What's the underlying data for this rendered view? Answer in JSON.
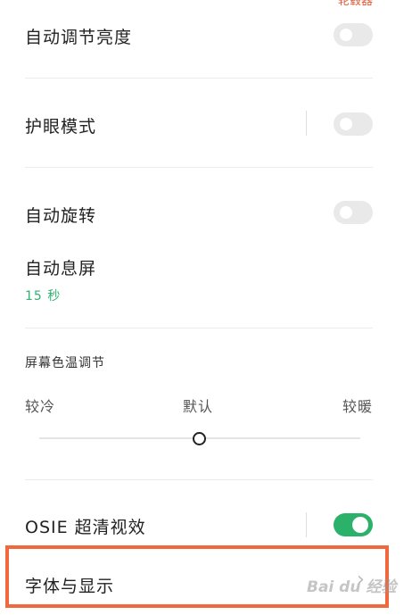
{
  "top_cut_text": "轮毂器",
  "rows": {
    "auto_brightness": {
      "label": "自动调节亮度",
      "on": false
    },
    "eye_care": {
      "label": "护眼模式",
      "on": false
    },
    "auto_rotate": {
      "label": "自动旋转",
      "on": false
    },
    "screen_timeout": {
      "label": "自动息屏",
      "value": "15 秒"
    },
    "osie": {
      "label": "OSIE 超清视效",
      "on": true
    },
    "font_display": {
      "label": "字体与显示"
    }
  },
  "color_temp": {
    "label": "屏幕色温调节",
    "cool": "较冷",
    "default": "默认",
    "warm": "较暖",
    "level": 0.5
  },
  "watermark": {
    "text": "Bai du 经验"
  },
  "colors": {
    "accent_green": "#2bb16a",
    "highlight_orange": "#f2683e"
  }
}
